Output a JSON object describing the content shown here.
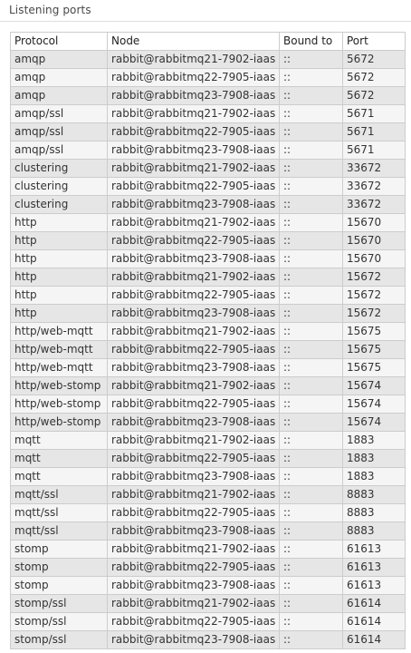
{
  "section": {
    "title": "Listening ports"
  },
  "table": {
    "columns": [
      "Protocol",
      "Node",
      "Bound to",
      "Port"
    ],
    "rows": [
      [
        "amqp",
        "rabbit@rabbitmq21-7902-iaas",
        "::",
        "5672"
      ],
      [
        "amqp",
        "rabbit@rabbitmq22-7905-iaas",
        "::",
        "5672"
      ],
      [
        "amqp",
        "rabbit@rabbitmq23-7908-iaas",
        "::",
        "5672"
      ],
      [
        "amqp/ssl",
        "rabbit@rabbitmq21-7902-iaas",
        "::",
        "5671"
      ],
      [
        "amqp/ssl",
        "rabbit@rabbitmq22-7905-iaas",
        "::",
        "5671"
      ],
      [
        "amqp/ssl",
        "rabbit@rabbitmq23-7908-iaas",
        "::",
        "5671"
      ],
      [
        "clustering",
        "rabbit@rabbitmq21-7902-iaas",
        "::",
        "33672"
      ],
      [
        "clustering",
        "rabbit@rabbitmq22-7905-iaas",
        "::",
        "33672"
      ],
      [
        "clustering",
        "rabbit@rabbitmq23-7908-iaas",
        "::",
        "33672"
      ],
      [
        "http",
        "rabbit@rabbitmq21-7902-iaas",
        "::",
        "15670"
      ],
      [
        "http",
        "rabbit@rabbitmq22-7905-iaas",
        "::",
        "15670"
      ],
      [
        "http",
        "rabbit@rabbitmq23-7908-iaas",
        "::",
        "15670"
      ],
      [
        "http",
        "rabbit@rabbitmq21-7902-iaas",
        "::",
        "15672"
      ],
      [
        "http",
        "rabbit@rabbitmq22-7905-iaas",
        "::",
        "15672"
      ],
      [
        "http",
        "rabbit@rabbitmq23-7908-iaas",
        "::",
        "15672"
      ],
      [
        "http/web-mqtt",
        "rabbit@rabbitmq21-7902-iaas",
        "::",
        "15675"
      ],
      [
        "http/web-mqtt",
        "rabbit@rabbitmq22-7905-iaas",
        "::",
        "15675"
      ],
      [
        "http/web-mqtt",
        "rabbit@rabbitmq23-7908-iaas",
        "::",
        "15675"
      ],
      [
        "http/web-stomp",
        "rabbit@rabbitmq21-7902-iaas",
        "::",
        "15674"
      ],
      [
        "http/web-stomp",
        "rabbit@rabbitmq22-7905-iaas",
        "::",
        "15674"
      ],
      [
        "http/web-stomp",
        "rabbit@rabbitmq23-7908-iaas",
        "::",
        "15674"
      ],
      [
        "mqtt",
        "rabbit@rabbitmq21-7902-iaas",
        "::",
        "1883"
      ],
      [
        "mqtt",
        "rabbit@rabbitmq22-7905-iaas",
        "::",
        "1883"
      ],
      [
        "mqtt",
        "rabbit@rabbitmq23-7908-iaas",
        "::",
        "1883"
      ],
      [
        "mqtt/ssl",
        "rabbit@rabbitmq21-7902-iaas",
        "::",
        "8883"
      ],
      [
        "mqtt/ssl",
        "rabbit@rabbitmq22-7905-iaas",
        "::",
        "8883"
      ],
      [
        "mqtt/ssl",
        "rabbit@rabbitmq23-7908-iaas",
        "::",
        "8883"
      ],
      [
        "stomp",
        "rabbit@rabbitmq21-7902-iaas",
        "::",
        "61613"
      ],
      [
        "stomp",
        "rabbit@rabbitmq22-7905-iaas",
        "::",
        "61613"
      ],
      [
        "stomp",
        "rabbit@rabbitmq23-7908-iaas",
        "::",
        "61613"
      ],
      [
        "stomp/ssl",
        "rabbit@rabbitmq21-7902-iaas",
        "::",
        "61614"
      ],
      [
        "stomp/ssl",
        "rabbit@rabbitmq22-7905-iaas",
        "::",
        "61614"
      ],
      [
        "stomp/ssl",
        "rabbit@rabbitmq23-7908-iaas",
        "::",
        "61614"
      ]
    ]
  }
}
